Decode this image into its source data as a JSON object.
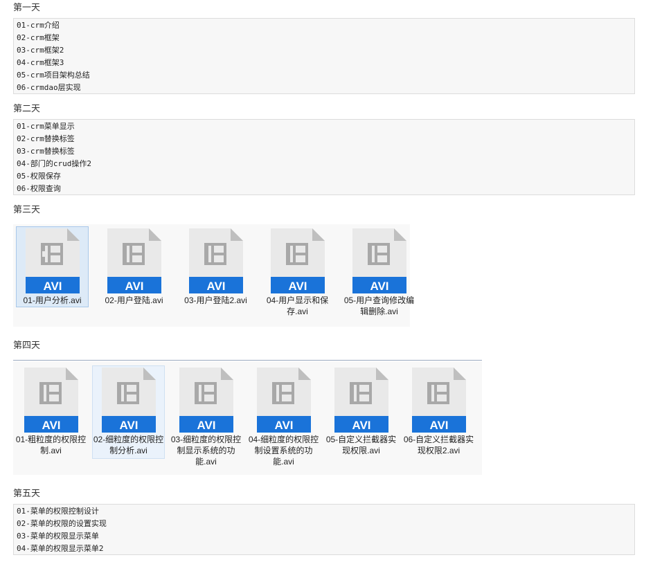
{
  "day1": {
    "heading": "第一天",
    "lines": [
      "01-crm介绍",
      "02-crm框架",
      "03-crm框架2",
      "04-crm框架3",
      "05-crm项目架构总结",
      "06-crmdao层实现"
    ]
  },
  "day2": {
    "heading": "第二天",
    "lines": [
      "01-crm菜单显示",
      "02-crm替换标签",
      "03-crm替换标签",
      "04-部门的crud操作2",
      "05-权限保存",
      "06-权限查询"
    ]
  },
  "day3": {
    "heading": "第三天",
    "files": [
      {
        "name": "01-用户分析.avi",
        "ext": "AVI"
      },
      {
        "name": "02-用户登陆.avi",
        "ext": "AVI"
      },
      {
        "name": "03-用户登陆2.avi",
        "ext": "AVI"
      },
      {
        "name": "04-用户显示和保存.avi",
        "ext": "AVI"
      },
      {
        "name": "05-用户查询修改编辑删除.avi",
        "ext": "AVI"
      }
    ]
  },
  "day4": {
    "heading": "第四天",
    "files": [
      {
        "name": "01-粗粒度的权限控制.avi",
        "ext": "AVI"
      },
      {
        "name": "02-细粒度的权限控制分析.avi",
        "ext": "AVI"
      },
      {
        "name": "03-细粒度的权限控制显示系统的功能.avi",
        "ext": "AVI"
      },
      {
        "name": "04-细粒度的权限控制设置系统的功能.avi",
        "ext": "AVI"
      },
      {
        "name": "05-自定义拦截器实现权限.avi",
        "ext": "AVI"
      },
      {
        "name": "06-自定义拦截器实现权限2.avi",
        "ext": "AVI"
      }
    ]
  },
  "day5": {
    "heading": "第五天",
    "lines": [
      "01-菜单的权限控制设计",
      "02-菜单的权限的设置实现",
      "03-菜单的权限显示菜单",
      "04-菜单的权限显示菜单2"
    ]
  },
  "colors": {
    "avi_band": "#1a73d9",
    "file_body": "#e9e9e9",
    "file_fold": "#bfbfbf",
    "film_icon": "#a8a8a8",
    "selected_bg": "#ddeaf7"
  },
  "icons": {
    "file": "video-file-icon"
  }
}
